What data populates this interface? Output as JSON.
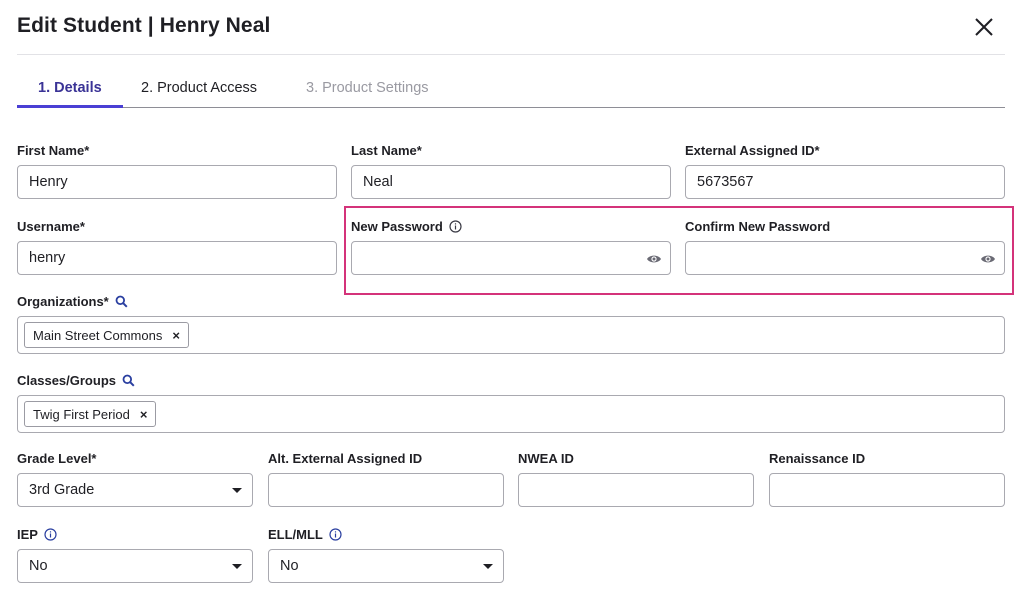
{
  "header": {
    "title": "Edit Student | Henry Neal"
  },
  "tabs": [
    {
      "label": "1. Details",
      "state": "active"
    },
    {
      "label": "2. Product Access",
      "state": "normal"
    },
    {
      "label": "3. Product Settings",
      "state": "disabled"
    }
  ],
  "form": {
    "first_name": {
      "label": "First Name*",
      "value": "Henry"
    },
    "last_name": {
      "label": "Last Name*",
      "value": "Neal"
    },
    "external_id": {
      "label": "External Assigned ID*",
      "value": "5673567"
    },
    "username": {
      "label": "Username*",
      "value": "henry"
    },
    "new_password": {
      "label": "New Password",
      "value": ""
    },
    "confirm_password": {
      "label": "Confirm New Password",
      "value": ""
    },
    "organizations": {
      "label": "Organizations*",
      "chips": [
        "Main Street Commons"
      ]
    },
    "classes": {
      "label": "Classes/Groups",
      "chips": [
        "Twig First Period"
      ]
    },
    "grade_level": {
      "label": "Grade Level*",
      "value": "3rd Grade"
    },
    "alt_external_id": {
      "label": "Alt. External Assigned ID",
      "value": ""
    },
    "nwea_id": {
      "label": "NWEA ID",
      "value": ""
    },
    "renaissance_id": {
      "label": "Renaissance ID",
      "value": ""
    },
    "iep": {
      "label": "IEP",
      "value": "No"
    },
    "ell_mll": {
      "label": "ELL/MLL",
      "value": "No"
    }
  },
  "colors": {
    "accent": "#4a3fd4",
    "active_tab_text": "#3a3396",
    "highlight": "#d4337a",
    "border": "#a9a9b0"
  },
  "icons": {
    "close": "close-icon",
    "info": "info-icon",
    "search": "search-icon",
    "eye": "eye-icon",
    "caret": "chevron-down-icon",
    "chip_remove": "remove-icon"
  }
}
